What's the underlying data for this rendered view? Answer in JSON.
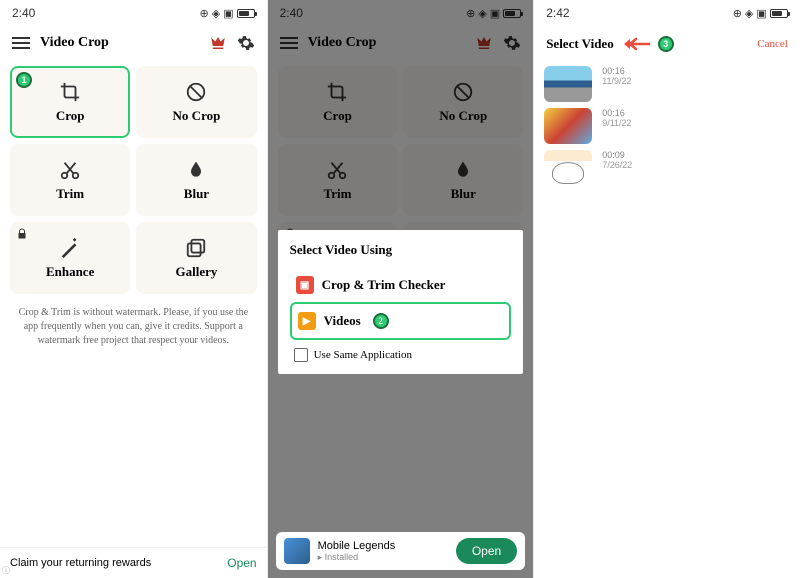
{
  "statusbar": {
    "time1": "2:40",
    "time2": "2:40",
    "time3": "2:42"
  },
  "header": {
    "title": "Video Crop"
  },
  "tiles": {
    "crop": "Crop",
    "nocrop": "No Crop",
    "trim": "Trim",
    "blur": "Blur",
    "enhance": "Enhance",
    "gallery": "Gallery"
  },
  "description": "Crop & Trim is without watermark. Please, if you use the app frequently when you can, give it credits. Support a watermark free project that respect your videos.",
  "ad1": {
    "text": "Claim your returning rewards",
    "button": "Open"
  },
  "ad2": {
    "title": "Mobile Legends",
    "sub": "▸ Installed",
    "button": "Open"
  },
  "dialog": {
    "title": "Select Video Using",
    "option1": "Crop & Trim Checker",
    "option2": "Videos",
    "checkbox": "Use Same Application"
  },
  "screen3": {
    "title": "Select Video",
    "cancel": "Cancel",
    "items": [
      {
        "dur": "00:16",
        "date": "11/9/22"
      },
      {
        "dur": "00:16",
        "date": "9/11/22"
      },
      {
        "dur": "00:09",
        "date": "7/26/22"
      }
    ]
  },
  "steps": {
    "s1": "1",
    "s2": "2",
    "s3": "3"
  }
}
